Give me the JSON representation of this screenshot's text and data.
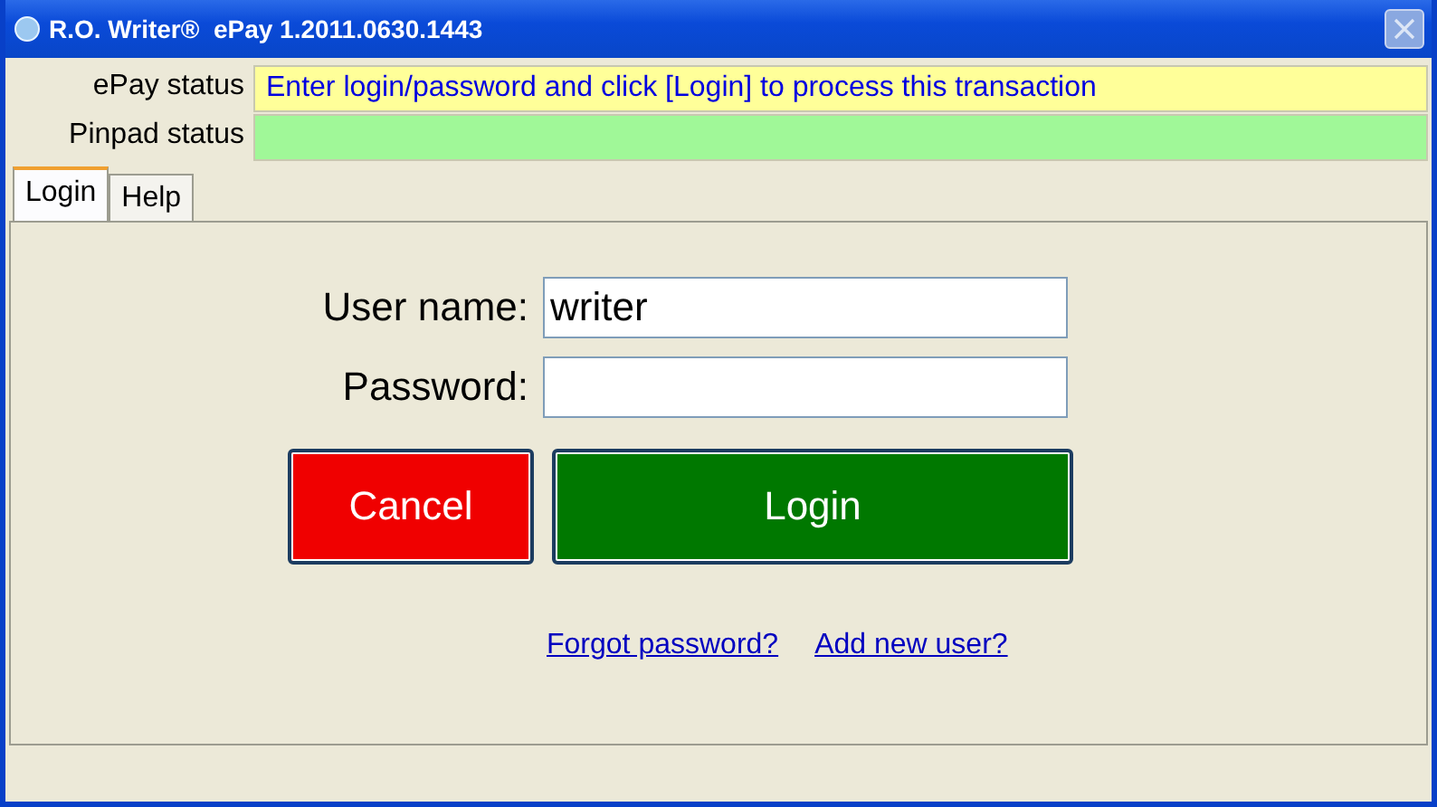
{
  "window": {
    "title": "R.O. Writer®  ePay 1.2011.0630.1443"
  },
  "status": [
    {
      "label": "ePay status",
      "value": "Enter login/password and click [Login] to process this transaction",
      "color": "#ffff99"
    },
    {
      "label": "Pinpad status",
      "color": "#a0f898"
    }
  ],
  "tabs": [
    {
      "label": "Login",
      "selected": true
    },
    {
      "label": "Help",
      "selected": false
    }
  ],
  "form": {
    "fields": [
      {
        "label": "User name:",
        "value": "writer"
      },
      {
        "label": "Password:"
      }
    ],
    "buttons": [
      {
        "label": "Cancel",
        "kind": "cancel"
      },
      {
        "label": "Login",
        "kind": "login"
      }
    ],
    "links": [
      "Forgot password?",
      "Add new user?"
    ]
  }
}
